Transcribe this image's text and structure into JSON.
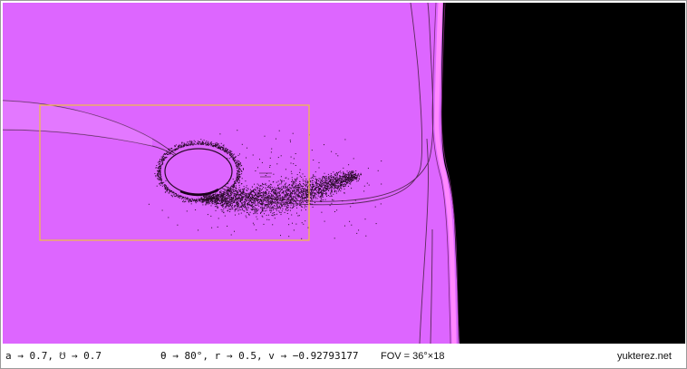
{
  "status": {
    "spin_text": "a → 0.7, ☋ → 0.7",
    "orbit_text": "θ → 80°, r → 0.5, v → −0.92793177",
    "fov_text": "FOV = 36°×18",
    "site_text": "yukterez.net"
  },
  "colors": {
    "background": "#dd66ff",
    "horizon": "#000000",
    "selection": "#f0c040",
    "photon_ring": "#ff88ff",
    "particles": "#2a0a2a"
  },
  "particles": {
    "seed": 7,
    "disk_count": 2600,
    "ring_count": 900,
    "scatter_count": 700
  }
}
